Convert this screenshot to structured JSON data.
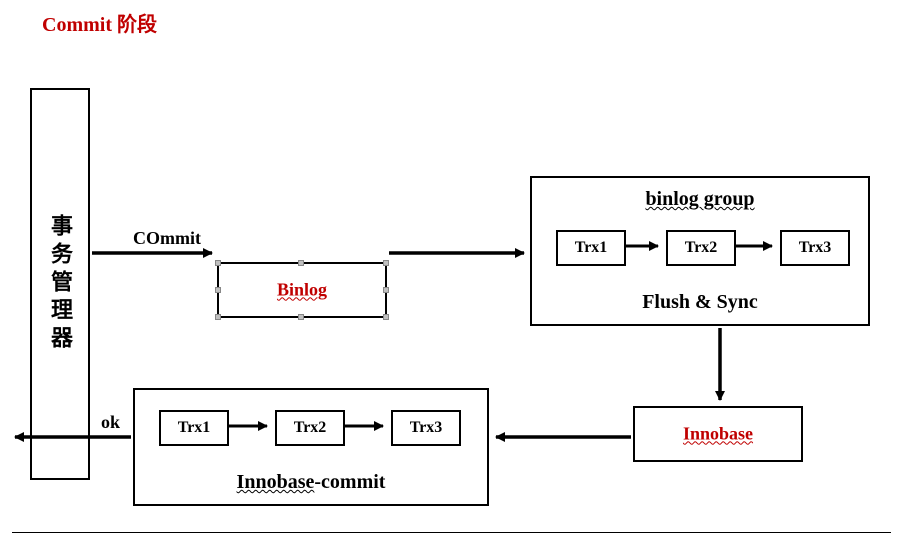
{
  "title": "Commit  阶段",
  "transaction_manager": {
    "label": "事务管理器"
  },
  "edges": {
    "commit_label": "COmmit",
    "ok_label": "ok"
  },
  "binlog_box": {
    "label": "Binlog"
  },
  "binlog_group": {
    "title": "binlog group",
    "trx": [
      "Trx1",
      "Trx2",
      "Trx3"
    ],
    "footer": "Flush & Sync"
  },
  "innobase_box": {
    "label": "Innobase"
  },
  "innobase_commit": {
    "trx": [
      "Trx1",
      "Trx2",
      "Trx3"
    ],
    "footer_underlined": "Innobase",
    "footer_suffix": "-commit"
  }
}
